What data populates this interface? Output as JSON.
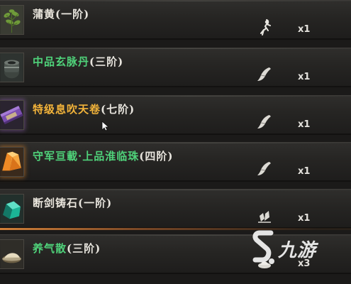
{
  "items": [
    {
      "name": "蒲黄",
      "grade": "(一阶)",
      "name_color": "#e9e5dc",
      "quantity": "x1",
      "icon": "herb-plant-icon",
      "badge": "root-icon"
    },
    {
      "name": "中品玄脉丹",
      "grade": "(三阶)",
      "name_color": "#4fd27a",
      "quantity": "x1",
      "icon": "pill-jar-icon",
      "badge": "scroll-icon"
    },
    {
      "name": "特级息吹天卷",
      "grade": "(七阶)",
      "name_color": "#f3b43a",
      "quantity": "x1",
      "icon": "purple-scroll-icon",
      "badge": "scroll-icon"
    },
    {
      "name": "守军亘載·上品淮临珠",
      "grade": "(四阶)",
      "name_color": "#4fd27a",
      "quantity": "x1",
      "icon": "orange-crystal-icon",
      "badge": "scroll-icon"
    },
    {
      "name": "断剑铸石",
      "grade": "(一阶)",
      "name_color": "#e9e5dc",
      "quantity": "x1",
      "icon": "green-ore-icon",
      "badge": "ore-shards-icon"
    },
    {
      "name": "养气散",
      "grade": "(三阶)",
      "name_color": "#4fd27a",
      "quantity": "x3",
      "icon": "powder-dish-icon",
      "badge": "powder-icon"
    }
  ],
  "watermark": {
    "text": "九游"
  },
  "colors": {
    "common": "#e9e5dc",
    "uncommon": "#4fd27a",
    "legendary": "#f3b43a"
  }
}
